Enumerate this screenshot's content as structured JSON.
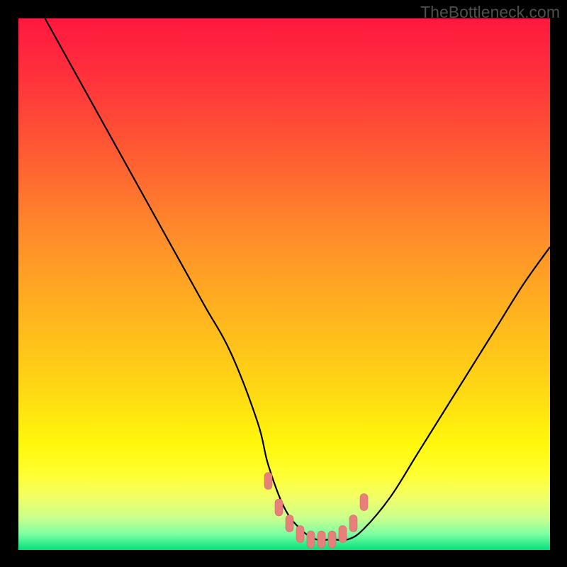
{
  "watermark": "TheBottleneck.com",
  "colors": {
    "gradient_stops": [
      {
        "offset": 0.0,
        "color": "#ff183f"
      },
      {
        "offset": 0.1,
        "color": "#ff2f3c"
      },
      {
        "offset": 0.25,
        "color": "#ff5a33"
      },
      {
        "offset": 0.4,
        "color": "#ff8a2b"
      },
      {
        "offset": 0.55,
        "color": "#ffb21f"
      },
      {
        "offset": 0.7,
        "color": "#ffd814"
      },
      {
        "offset": 0.8,
        "color": "#fff70b"
      },
      {
        "offset": 0.86,
        "color": "#ffff33"
      },
      {
        "offset": 0.9,
        "color": "#f2ff66"
      },
      {
        "offset": 0.94,
        "color": "#c9ff8c"
      },
      {
        "offset": 0.97,
        "color": "#7dffa3"
      },
      {
        "offset": 1.0,
        "color": "#00e17a"
      }
    ],
    "curve": "#000000",
    "marker_fill": "#e77f7a",
    "marker_stroke": "#d66b66"
  },
  "chart_data": {
    "type": "line",
    "title": "",
    "xlabel": "",
    "ylabel": "",
    "xlim": [
      0,
      100
    ],
    "ylim": [
      0,
      100
    ],
    "series": [
      {
        "name": "bottleneck-curve",
        "x": [
          5,
          10,
          15,
          20,
          25,
          30,
          35,
          40,
          45,
          47,
          50,
          53,
          56,
          59,
          62,
          65,
          70,
          75,
          80,
          85,
          90,
          95,
          100
        ],
        "y": [
          100,
          91,
          82,
          73,
          64,
          55,
          46,
          37,
          24,
          16,
          8,
          4,
          2,
          2,
          2,
          4,
          10,
          18,
          26,
          34,
          42,
          50,
          57
        ]
      }
    ],
    "markers": {
      "name": "highlight-points",
      "x": [
        47,
        49,
        51,
        53,
        55,
        57,
        59,
        61,
        63,
        65
      ],
      "y": [
        13,
        8,
        5,
        3,
        2,
        2,
        2,
        3,
        5,
        9
      ]
    }
  }
}
